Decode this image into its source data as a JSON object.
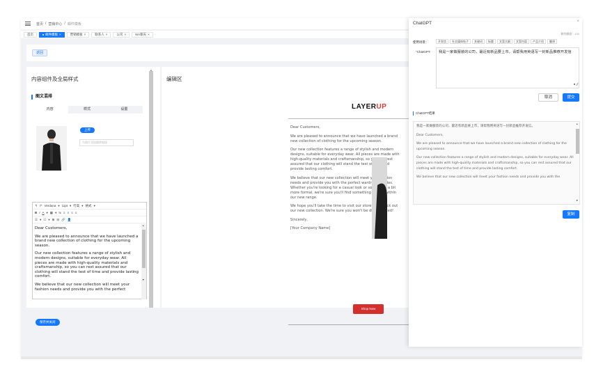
{
  "breadcrumb": {
    "items": [
      "首页",
      "营销中心",
      "邮件模板"
    ]
  },
  "tabs": [
    {
      "label": "首页",
      "active": false
    },
    {
      "label": "邮件模板",
      "active": true
    },
    {
      "label": "营销模板",
      "active": false
    },
    {
      "label": "联系人",
      "active": false
    },
    {
      "label": "公司",
      "active": false
    },
    {
      "label": "WA聊天",
      "active": false
    }
  ],
  "back_button": "返回",
  "left_panel": {
    "title": "内容组件及全局样式",
    "section": "图文混排",
    "subtabs": [
      "内容",
      "样式",
      "设置"
    ],
    "upload_button": "上传",
    "image_link_placeholder": "为图片添加跳转链接",
    "toolbar": {
      "row1": [
        "↰",
        "↱",
        "Verdana",
        "▾",
        "11pt",
        "▾",
        "行高",
        "▾",
        "格式",
        "▾"
      ],
      "row2": [
        "B",
        "I",
        "A",
        "▾",
        "▦",
        "▾",
        "Ix",
        "≡",
        "≡",
        "≡",
        "≡"
      ],
      "row3": [
        "☰",
        "▾",
        "☷",
        "▾",
        "⊞",
        "⊟",
        "🔗",
        "👤"
      ]
    },
    "editor_paragraphs": [
      "Dear Customers,",
      "We are pleased to announce that we have launched a brand new collection of clothing for the upcoming season.",
      "Our new collection features a range of stylish and modern designs, suitable for everyday wear. All pieces are made with high-quality materials and craftsmanship, so you can rest assured that our clothing will stand the test of time and provide lasting comfort.",
      "We believe that our new collection will meet your fashion needs and provide you with the perfect"
    ],
    "save_close_button": "保存并关闭"
  },
  "edit_area": {
    "title": "编辑区",
    "logo_main": "LAYER",
    "logo_accent": "UP",
    "email_paragraphs": [
      "Dear Customers,",
      "We are pleased to announce that we have launched a brand new collection of clothing for the upcoming season.",
      "Our new collection features a range of stylish and modern designs, suitable for everyday wear. All pieces are made with high-quality materials and craftsmanship, so you can rest assured that our clothing will stand the test of time and provide lasting comfort.",
      "We believe that our new collection will meet your fashion needs and provide you with the perfect wardrobe staples. Whether you're looking for a casual look or something a bit more formal, we're sure you'll find something to love within our new range.",
      "We hope you'll take the time to visit our store and check out our new collection. We're sure you won't be disappointed!",
      "Sincerely,",
      "[Your Company Name]"
    ],
    "shop_button": "Shop Now"
  },
  "chatgpt": {
    "title": "ChatGPT",
    "counter": "剩余额度：100",
    "scene_label": "使用场景：",
    "scenes": [
      "开发信",
      "社交媒体帖子",
      "关键词",
      "标题",
      "文案大纲",
      "文案内容",
      "产品介绍",
      "翻译"
    ],
    "prompt_label": "ChatGPT:",
    "prompt_required": "*",
    "prompt_text": "我是一家做服装的公司，最近有新品要上市，请帮我用英语写一封新品推荐开发信",
    "cancel_button": "取消",
    "submit_button": "提交",
    "result_title": "ChatGPT结果",
    "result_paragraphs": [
      "我是一家做服装的公司，最近有新品要上市，请帮我用英语写一封新品推荐开发信。",
      "Dear Customers,",
      "We are pleased to announce that we have launched a brand new collection of clothing for the upcoming season.",
      "Our new collection features a range of stylish and modern designs, suitable for everyday wear. All pieces are made with high-quality materials and craftsmanship, so you can rest assured that our clothing will stand the test of time and provide lasting comfort.",
      "We believe that our new collection will meet your fashion needs and provide you with the"
    ],
    "copy_button": "复制"
  },
  "colors": {
    "accent": "#1677ff",
    "brand_red": "#d32f2f"
  }
}
